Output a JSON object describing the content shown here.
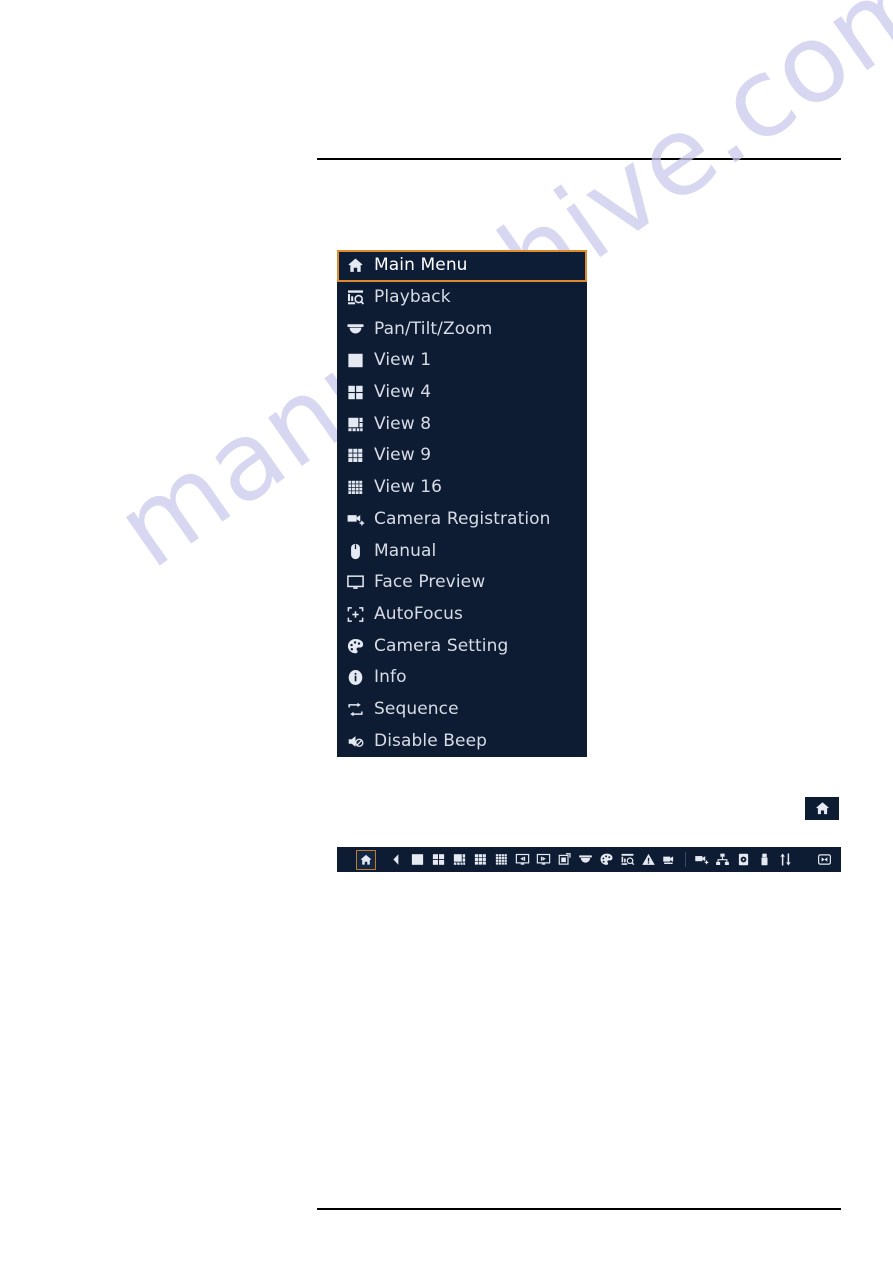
{
  "page": {
    "background_color": "#ffffff",
    "rule_color": "#000000",
    "watermark": "manualshive.com",
    "watermark_color": "#c9c9ee"
  },
  "context_menu": {
    "background_color": "#0d1b33",
    "selected_border_color": "#e08a2e",
    "text_color": "#d7dce6",
    "items": [
      {
        "label": "Main Menu",
        "icon": "home-icon",
        "selected": true
      },
      {
        "label": "Playback",
        "icon": "playback-search-icon",
        "selected": false
      },
      {
        "label": "Pan/Tilt/Zoom",
        "icon": "dome-camera-icon",
        "selected": false
      },
      {
        "label": "View 1",
        "icon": "view-1-grid-icon",
        "selected": false
      },
      {
        "label": "View 4",
        "icon": "view-4-grid-icon",
        "selected": false
      },
      {
        "label": "View 8",
        "icon": "view-8-grid-icon",
        "selected": false
      },
      {
        "label": "View 9",
        "icon": "view-9-grid-icon",
        "selected": false
      },
      {
        "label": "View 16",
        "icon": "view-16-grid-icon",
        "selected": false
      },
      {
        "label": "Camera Registration",
        "icon": "camera-registration-icon",
        "selected": false
      },
      {
        "label": "Manual",
        "icon": "mouse-icon",
        "selected": false
      },
      {
        "label": "Face Preview",
        "icon": "monitor-icon",
        "selected": false
      },
      {
        "label": "AutoFocus",
        "icon": "autofocus-icon",
        "selected": false
      },
      {
        "label": "Camera Setting",
        "icon": "color-palette-icon",
        "selected": false
      },
      {
        "label": "Info",
        "icon": "info-icon",
        "selected": false
      },
      {
        "label": "Sequence",
        "icon": "sequence-icon",
        "selected": false
      },
      {
        "label": "Disable Beep",
        "icon": "speaker-mute-icon",
        "selected": false
      }
    ]
  },
  "home_float_button": {
    "icon": "home-icon",
    "label": "Home"
  },
  "navbar": {
    "background_color": "#0d1b33",
    "selected_border_color": "#c07a2a",
    "left_buttons": [
      {
        "icon": "home-icon",
        "label": "Main Menu",
        "selected": true
      },
      {
        "icon": "previous-arrow-icon",
        "label": "Previous",
        "selected": false
      },
      {
        "icon": "view-1-grid-icon",
        "label": "View 1",
        "selected": false
      },
      {
        "icon": "view-4-grid-icon",
        "label": "View 4",
        "selected": false
      },
      {
        "icon": "view-8-grid-icon",
        "label": "View 8",
        "selected": false
      },
      {
        "icon": "view-9-grid-icon",
        "label": "View 9",
        "selected": false
      },
      {
        "icon": "view-16-grid-icon",
        "label": "View 16",
        "selected": false
      },
      {
        "icon": "screen-prev-icon",
        "label": "Previous Screen",
        "selected": false
      },
      {
        "icon": "screen-next-icon",
        "label": "Next Screen",
        "selected": false
      },
      {
        "icon": "tour-icon",
        "label": "Tour",
        "selected": false
      }
    ],
    "right_buttons": [
      {
        "icon": "dome-camera-icon",
        "label": "PTZ"
      },
      {
        "icon": "color-palette-icon",
        "label": "Camera Setting"
      },
      {
        "icon": "playback-search-icon",
        "label": "Search"
      },
      {
        "icon": "alarm-warning-icon",
        "label": "Alarm Status"
      },
      {
        "icon": "channel-info-icon",
        "label": "Channel Info"
      },
      {
        "icon": "camera-registration-icon",
        "label": "Camera Registration"
      },
      {
        "icon": "network-icon",
        "label": "Network"
      },
      {
        "icon": "hdd-icon",
        "label": "HDD Manager"
      },
      {
        "icon": "usb-icon",
        "label": "USB Manager"
      },
      {
        "icon": "updown-arrows-icon",
        "label": "Traffic"
      }
    ],
    "end_buttons": [
      {
        "icon": "close-boxed-icon",
        "label": "Exit"
      }
    ]
  }
}
